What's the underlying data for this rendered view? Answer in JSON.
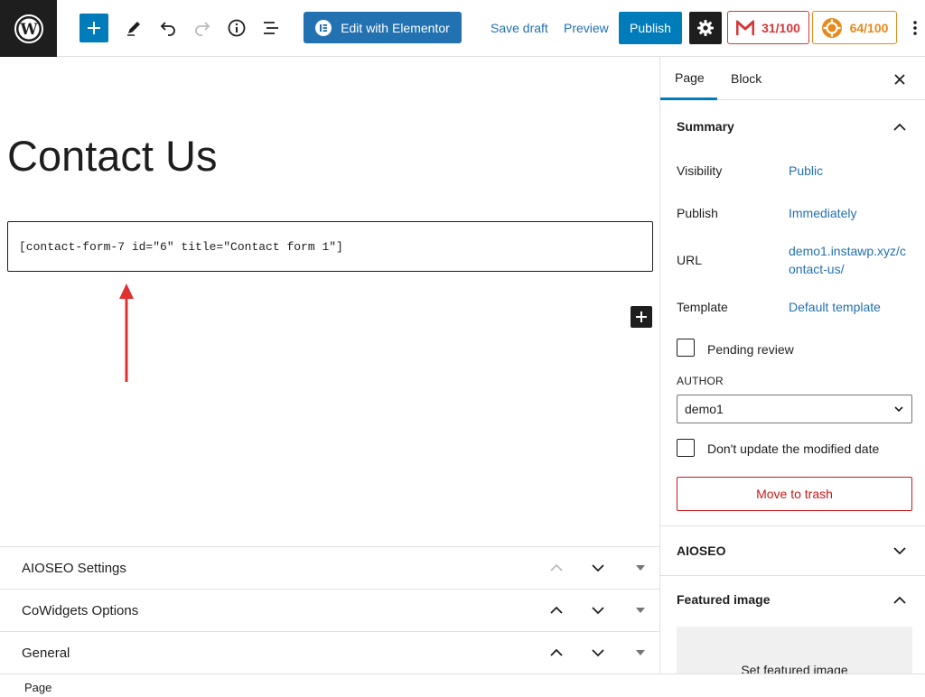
{
  "toolbar": {
    "elementor_label": "Edit with Elementor",
    "save_draft": "Save draft",
    "preview": "Preview",
    "publish": "Publish",
    "seo_score": "31/100",
    "readability_score": "64/100"
  },
  "editor": {
    "title": "Contact Us",
    "shortcode": "[contact-form-7 id=\"6\" title=\"Contact form 1\"]"
  },
  "metaboxes": [
    {
      "title": "AIOSEO Settings"
    },
    {
      "title": "CoWidgets Options"
    },
    {
      "title": "General"
    }
  ],
  "footer": {
    "breadcrumb": "Page"
  },
  "sidebar": {
    "tabs": {
      "page": "Page",
      "block": "Block"
    },
    "summary": {
      "title": "Summary",
      "visibility_label": "Visibility",
      "visibility_value": "Public",
      "publish_label": "Publish",
      "publish_value": "Immediately",
      "url_label": "URL",
      "url_line1": "demo1.instawp.xyz/c",
      "url_line2": "ontact-us/",
      "template_label": "Template",
      "template_value": "Default template",
      "pending_review": "Pending review",
      "author_label": "AUTHOR",
      "author_value": "demo1",
      "dont_update": "Don't update the modified date",
      "trash": "Move to trash"
    },
    "aioseo": {
      "title": "AIOSEO"
    },
    "featured": {
      "title": "Featured image",
      "set_label": "Set featured image"
    }
  },
  "colors": {
    "accent": "#007cba",
    "link": "#2271b1",
    "danger": "#cc1818",
    "annotation": "#e03131"
  }
}
